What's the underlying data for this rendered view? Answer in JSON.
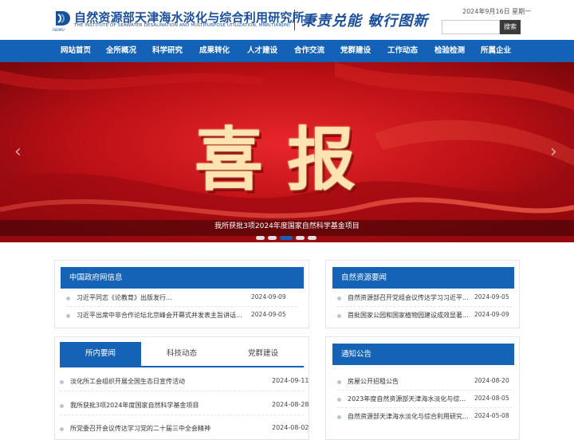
{
  "header": {
    "logo_mark_label": "ISDMU",
    "title_cn": "自然资源部天津海水淡化与综合利用研究所",
    "title_en": "THE INSTITUTE OF SEAWATER DESALINATION AND MULTIPURPOSE UTILIZATION, MNR(TIANJIN)",
    "slogan": "秉责兑能 敏行图新",
    "date": "2024年9月16日 星期一",
    "search_placeholder": "",
    "search_button": "搜索"
  },
  "nav": {
    "items": [
      "网站首页",
      "全所概况",
      "科学研究",
      "成果转化",
      "人才建设",
      "合作交流",
      "党群建设",
      "工作动态",
      "检验检测",
      "所属企业"
    ]
  },
  "banner": {
    "headline": "喜报",
    "caption": "我所获批3项2024年度国家自然科学基金项目",
    "prev_arrow": "‹",
    "next_arrow": "›",
    "slide_count": 5,
    "active_slide": 3
  },
  "gov_news": {
    "title": "中国政府网信息",
    "items": [
      {
        "text": "习近平同志《论教育》出版发行...",
        "date": "2024-09-09"
      },
      {
        "text": "习近平出席中非合作论坛北京峰会开幕式并发表主旨讲话...",
        "date": "2024-09-05"
      }
    ]
  },
  "mnr_news": {
    "title": "自然资源要闻",
    "items": [
      {
        "text": "自然资源部召开党组会议传达学习习近平...",
        "date": "2024-09-05"
      },
      {
        "text": "首批国家公园和国家植物园建设成效显著...",
        "date": "2024-09-09"
      }
    ]
  },
  "news_tabs": {
    "tabs": [
      "所内要闻",
      "科技动态",
      "党群建设"
    ],
    "active": 0,
    "items": [
      {
        "text": "淡化所工会组织开展全国生态日宣传活动",
        "date": "2024-09-11"
      },
      {
        "text": "我所获批3项2024年度国家自然科学基金项目",
        "date": "2024-08-28"
      },
      {
        "text": "所党委召开会议传达学习党的二十届三中全会精神",
        "date": "2024-08-02"
      }
    ]
  },
  "notices": {
    "title": "通知公告",
    "items": [
      {
        "text": "房屋公开招租公告",
        "date": "2024-08-20"
      },
      {
        "text": "2023年度自然资源部天津海水淡化与综合...",
        "date": "2024-08-05"
      },
      {
        "text": "自然资源部天津海水淡化与综合利用研究...",
        "date": "2024-05-08"
      }
    ]
  },
  "colors": {
    "brand_blue": "#1563b6",
    "banner_red": "#b10f14"
  }
}
